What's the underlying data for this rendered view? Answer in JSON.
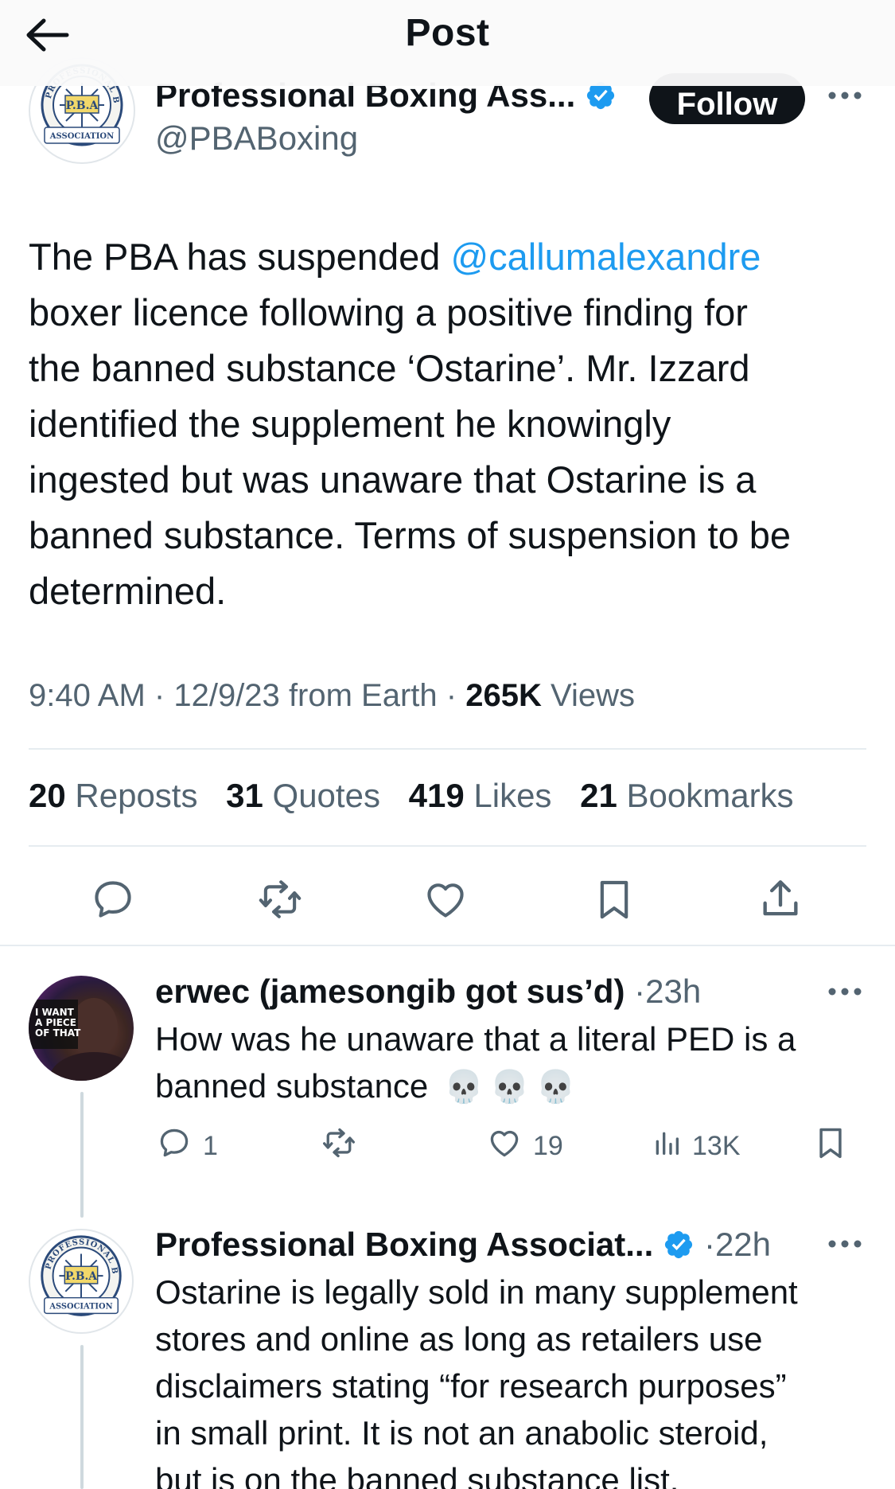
{
  "header": {
    "title": "Post"
  },
  "post": {
    "author": {
      "name": "Professional Boxing Ass...",
      "handle": "@PBABoxing",
      "avatar_ring_text": "PROFESSIONAL BOXING",
      "avatar_center_text": "P.B.A",
      "avatar_banner_text": "ASSOCIATION"
    },
    "follow_label": "Follow",
    "text_lines": [
      {
        "before": "The PBA has suspended ",
        "mention": "@callumalexandre"
      },
      {
        "text": "boxer licence following a positive finding for"
      },
      {
        "text": "the banned substance ‘Ostarine’.  Mr. Izzard"
      },
      {
        "text": "identified the supplement he knowingly"
      },
      {
        "text": "ingested but was unaware that Ostarine is a"
      },
      {
        "text": "banned substance. Terms of suspension to be"
      },
      {
        "text": "determined."
      }
    ],
    "meta": {
      "time": "9:40 AM",
      "date": "12/9/23",
      "from": "from Earth",
      "sep": "·",
      "views_count": "265K",
      "views_label": "Views"
    },
    "stats": {
      "reposts_count": "20",
      "reposts_label": "Reposts",
      "quotes_count": "31",
      "quotes_label": "Quotes",
      "likes_count": "419",
      "likes_label": "Likes",
      "bookmarks_count": "21",
      "bookmarks_label": "Bookmarks"
    },
    "actions": [
      "reply-icon",
      "repost-icon",
      "like-icon",
      "bookmark-icon",
      "share-icon"
    ]
  },
  "replies": [
    {
      "name": "erwec (jamesongib got sus’d)",
      "time": "23h",
      "avatar_text": [
        "I WANT",
        "A PIECE",
        "OF THAT"
      ],
      "text_lines": [
        "How was he unaware that a literal PED is a",
        "banned substance"
      ],
      "emoji": "💀",
      "emoji_icon": "skull-emoji",
      "reply_count": "1",
      "repost_count": "",
      "like_count": "19",
      "views_count": "13K"
    },
    {
      "name": "Professional Boxing Associat...",
      "time": "22h",
      "verified": true,
      "text_lines": [
        "Ostarine is legally sold in many supplement",
        "stores and online as long as retailers use",
        "disclaimers stating “for research purposes”",
        "in small print.  It is not an anabolic steroid,",
        "but is on the banned substance list."
      ]
    }
  ],
  "colors": {
    "text": "#0f1419",
    "secondary": "#536471",
    "accent": "#1d9bf0",
    "divider": "#e6ecf0",
    "follow_bg": "#0f1419"
  }
}
